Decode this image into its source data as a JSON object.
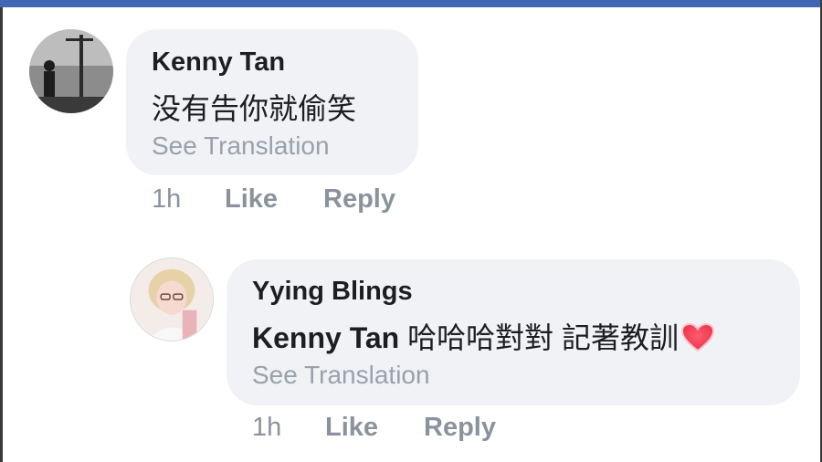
{
  "comments": [
    {
      "author": "Kenny Tan",
      "text": "没有告你就偷笑",
      "translate_label": "See Translation",
      "time": "1h",
      "like_label": "Like",
      "reply_label": "Reply"
    },
    {
      "author": "Yying Blings",
      "mention": "Kenny Tan",
      "text": "哈哈哈對對 記著教訓",
      "emoji_icon": "heart-emoji",
      "translate_label": "See Translation",
      "time": "1h",
      "like_label": "Like",
      "reply_label": "Reply"
    }
  ],
  "colors": {
    "topbar": "#4267b2",
    "bubble": "#f0f2f5",
    "meta": "#8a929d",
    "translate": "#9aa1ab",
    "heart": "#e8334a"
  }
}
